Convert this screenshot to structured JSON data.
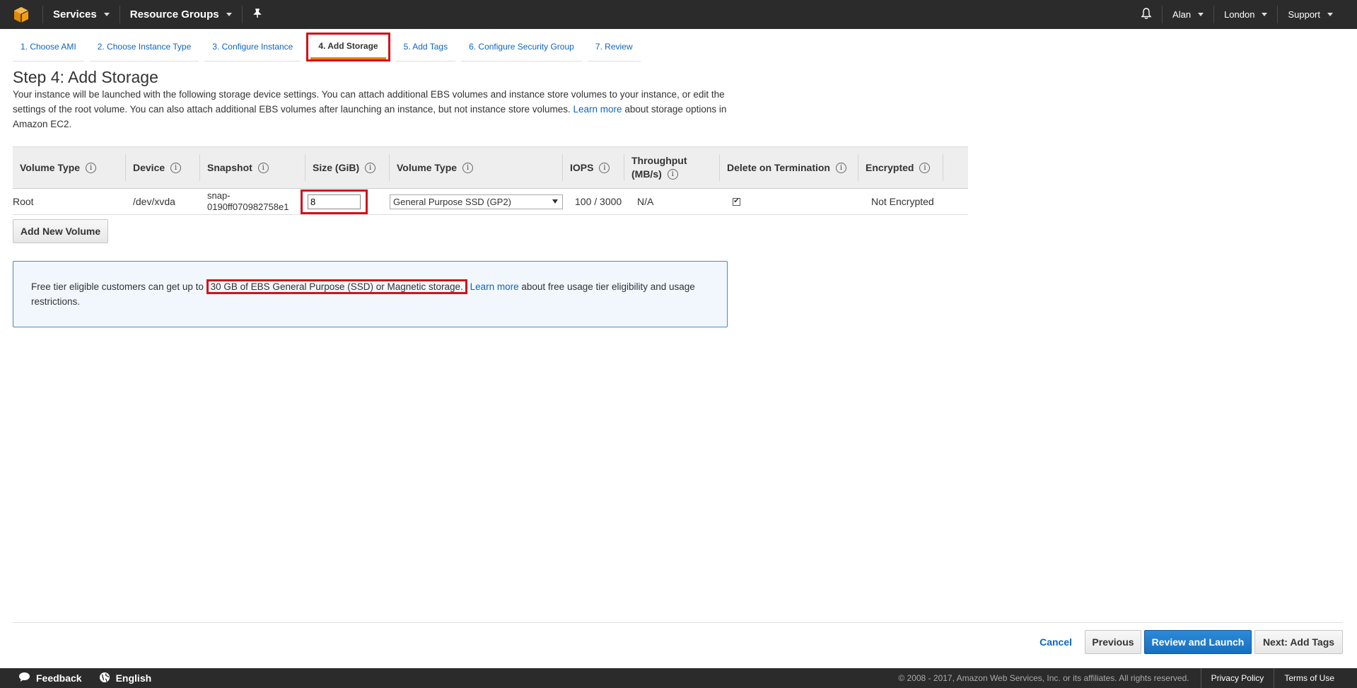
{
  "nav": {
    "services": "Services",
    "resource_groups": "Resource Groups",
    "user": "Alan",
    "region": "London",
    "support": "Support"
  },
  "tabs": [
    {
      "label": "1. Choose AMI"
    },
    {
      "label": "2. Choose Instance Type"
    },
    {
      "label": "3. Configure Instance"
    },
    {
      "label": "4. Add Storage",
      "active": true
    },
    {
      "label": "5. Add Tags"
    },
    {
      "label": "6. Configure Security Group"
    },
    {
      "label": "7. Review"
    }
  ],
  "page": {
    "title": "Step 4: Add Storage",
    "desc_before": "Your instance will be launched with the following storage device settings. You can attach additional EBS volumes and instance store volumes to your instance, or edit the settings of the root volume. You can also attach additional EBS volumes after launching an instance, but not instance store volumes.",
    "desc_link": "Learn more",
    "desc_after": "about storage options in Amazon EC2."
  },
  "table": {
    "headers": {
      "volume_type": "Volume Type",
      "device": "Device",
      "snapshot": "Snapshot",
      "size": "Size (GiB)",
      "ebs_type": "Volume Type",
      "iops": "IOPS",
      "throughput_1": "Throughput",
      "throughput_2": "(MB/s)",
      "delete": "Delete on Termination",
      "encrypted": "Encrypted"
    },
    "row": {
      "volume_type": "Root",
      "device": "/dev/xvda",
      "snapshot_1": "snap-",
      "snapshot_2": "0190ff070982758e1",
      "size": "8",
      "ebs_type": "General Purpose SSD (GP2)",
      "iops": "100 / 3000",
      "throughput": "N/A",
      "delete_checked": "✔",
      "encrypted": "Not Encrypted"
    }
  },
  "add_volume": "Add New Volume",
  "notice": {
    "before": "Free tier eligible customers can get up to",
    "highlight": "30 GB of EBS General Purpose (SSD) or Magnetic storage.",
    "link": "Learn more",
    "after": "about free usage tier eligibility and usage restrictions."
  },
  "actions": {
    "cancel": "Cancel",
    "previous": "Previous",
    "review": "Review and Launch",
    "next": "Next: Add Tags"
  },
  "footer": {
    "feedback": "Feedback",
    "language": "English",
    "copyright": "© 2008 - 2017, Amazon Web Services, Inc. or its affiliates. All rights reserved.",
    "privacy": "Privacy Policy",
    "terms": "Terms of Use"
  },
  "colors": {
    "accent": "#e7810c",
    "highlight_box": "#d0121b",
    "link": "#1066bb",
    "primary_button": "#1570c2"
  }
}
